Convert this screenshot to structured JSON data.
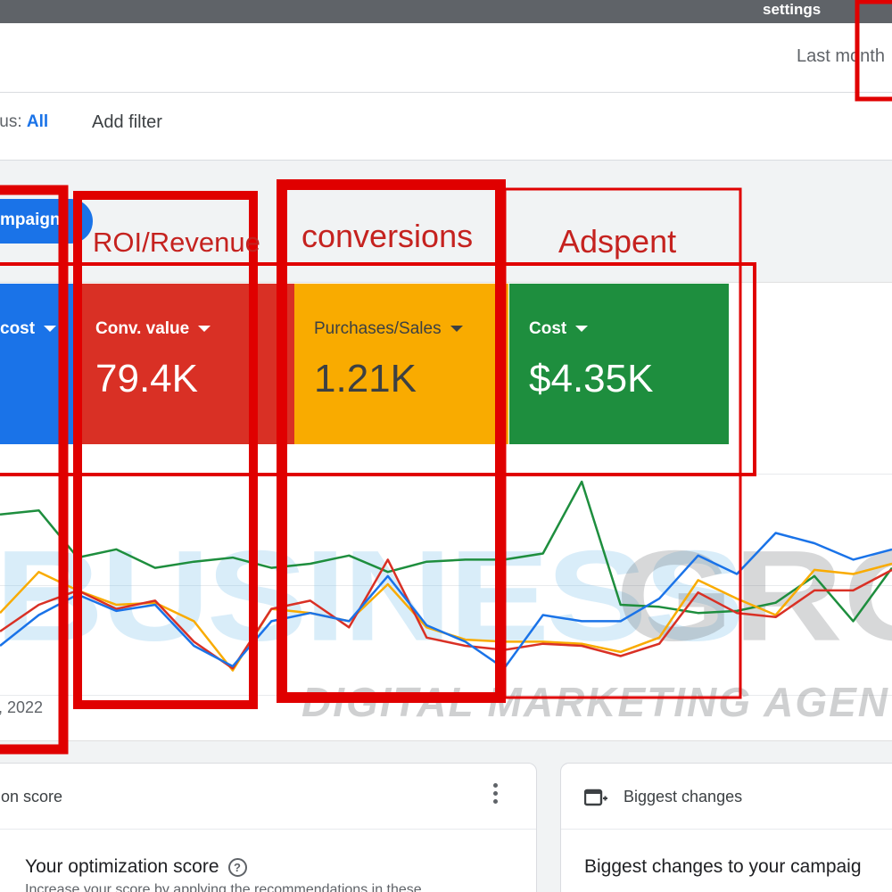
{
  "topbar": {
    "settings_label": "settings"
  },
  "datebar": {
    "date_range": "Last month"
  },
  "filters": {
    "status_label": "tus:",
    "status_value": "All",
    "add_filter": "Add filter"
  },
  "segment_chip": {
    "label": "mpaign"
  },
  "metric_tiles": [
    {
      "label": "cost",
      "value": "",
      "color": "#1a73e8"
    },
    {
      "label": "Conv. value",
      "value": "79.4K",
      "color": "#d93025"
    },
    {
      "label": "Purchases/Sales",
      "value": "1.21K",
      "color": "#f9ab00"
    },
    {
      "label": "Cost",
      "value": "$4.35K",
      "color": "#1e8e3e"
    }
  ],
  "chart_date_label": ", 2022",
  "annotations": {
    "roi": "ROI/Revenue",
    "conversions": "conversions",
    "adspent": "Adspent"
  },
  "watermark": {
    "big": "BUSINESS",
    "big2": "GROW",
    "small": "DIGITAL MARKETING AGEN"
  },
  "cards": {
    "optimization": {
      "header": "on score",
      "title": "Your optimization score",
      "subtitle": "Increase your score by applying the recommendations in these"
    },
    "biggest_changes": {
      "header": "Biggest changes",
      "title": "Biggest changes to your campaig"
    }
  },
  "chart_data": {
    "type": "line",
    "x": [
      0,
      1,
      2,
      3,
      4,
      5,
      6,
      7,
      8,
      9,
      10,
      11,
      12,
      13,
      14,
      15,
      16,
      17,
      18,
      19,
      20,
      21,
      22,
      23
    ],
    "series": [
      {
        "color": "#1e8e3e",
        "values": [
          84,
          86,
          63,
          67,
          58,
          61,
          63,
          58,
          60,
          64,
          56,
          61,
          62,
          62,
          65,
          100,
          40,
          39,
          36,
          37,
          41,
          54,
          32,
          58
        ]
      },
      {
        "color": "#f9ab00",
        "values": [
          36,
          56,
          47,
          40,
          41,
          32,
          8,
          38,
          36,
          32,
          50,
          29,
          23,
          22,
          22,
          21,
          17,
          24,
          52,
          43,
          35,
          57,
          55,
          60
        ]
      },
      {
        "color": "#d93025",
        "values": [
          27,
          40,
          47,
          38,
          42,
          22,
          9,
          38,
          42,
          29,
          62,
          24,
          20,
          18,
          21,
          20,
          15,
          21,
          46,
          36,
          34,
          47,
          47,
          57
        ]
      },
      {
        "color": "#1a73e8",
        "values": [
          20,
          35,
          45,
          37,
          40,
          20,
          10,
          32,
          36,
          32,
          54,
          30,
          22,
          9,
          35,
          32,
          32,
          43,
          64,
          55,
          75,
          70,
          62,
          67
        ]
      }
    ]
  }
}
